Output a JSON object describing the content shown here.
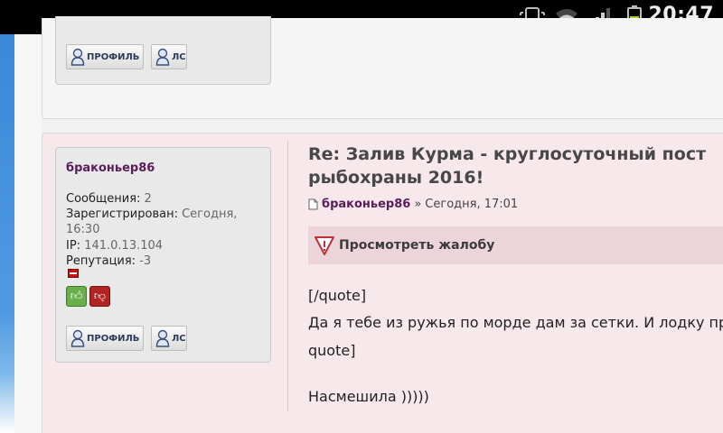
{
  "status_bar": {
    "time": "20:47",
    "icons": [
      "screenshot-icon",
      "wifi-icon",
      "signal-icon",
      "battery-icon"
    ]
  },
  "top_post": {
    "buttons": {
      "profile_label": "ПРОФИЛЬ",
      "pm_label": "ЛС"
    }
  },
  "post": {
    "user": {
      "name": "браконьер86",
      "messages_label": "Сообщения:",
      "messages_value": "2",
      "registered_label": "Зарегистрирован:",
      "registered_value_1": "Сегодня,",
      "registered_value_2": "16:30",
      "ip_label": "IP:",
      "ip_value": "141.0.13.104",
      "reputation_label": "Репутация:",
      "reputation_value": "-3"
    },
    "buttons": {
      "profile_label": "ПРОФИЛЬ",
      "pm_label": "ЛС"
    },
    "title_line1": "Re: Залив Курма - круглосуточный пост",
    "title_line2": "рыбохраны 2016!",
    "meta": {
      "author": "браконьер86",
      "separator": "»",
      "date": "Сегодня, 17:01"
    },
    "report_label": "Просмотреть жалобу",
    "body_lines": [
      "[/quote]",
      "Да я тебе из ружья по морде дам за сетки. И лодку пр",
      "quote]",
      "Насмешила )))))"
    ]
  },
  "colors": {
    "username": "#5a1d5a",
    "post_bg": "#f7e8eb",
    "report_bg": "#ecd5da",
    "statusbar_bg": "#000000",
    "accent_blue": "#4f9ae2"
  }
}
